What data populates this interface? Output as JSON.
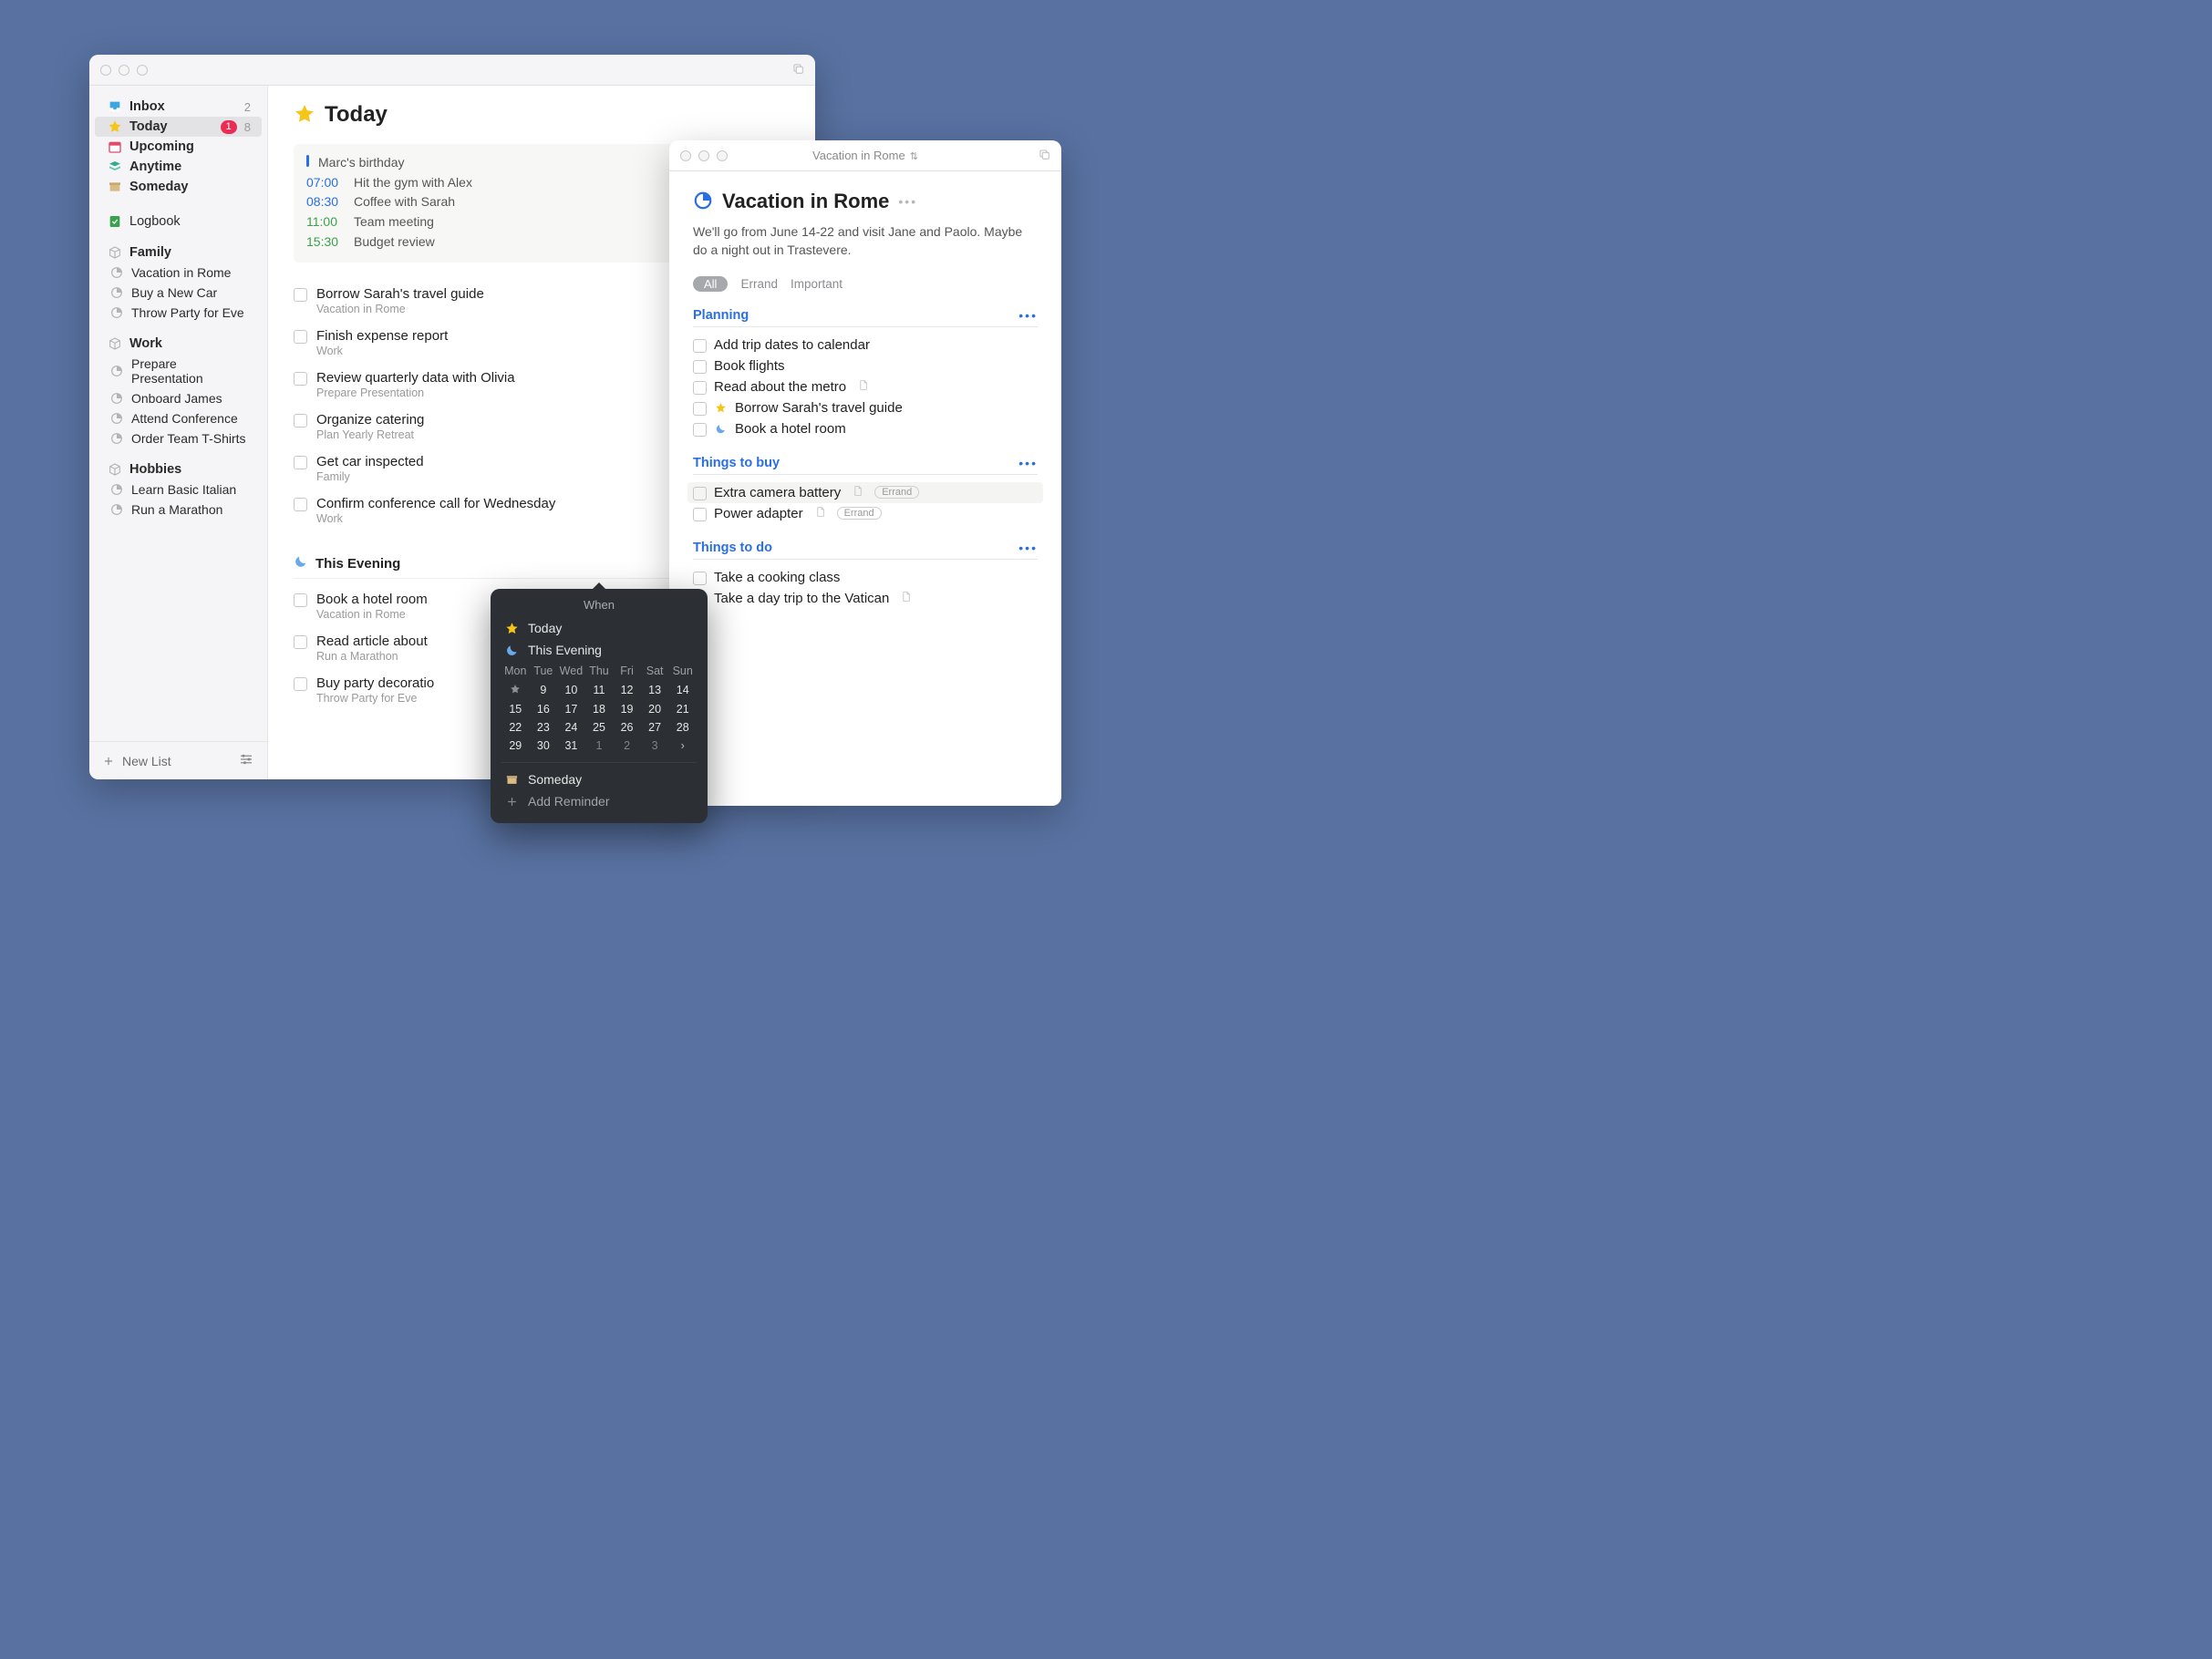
{
  "sidebar": {
    "smart": [
      {
        "icon": "inbox",
        "label": "Inbox",
        "count": "2"
      },
      {
        "icon": "star",
        "label": "Today",
        "badge": "1",
        "count": "8",
        "selected": true
      },
      {
        "icon": "calendar",
        "label": "Upcoming"
      },
      {
        "icon": "stack",
        "label": "Anytime"
      },
      {
        "icon": "archive",
        "label": "Someday"
      }
    ],
    "logbook": {
      "label": "Logbook"
    },
    "areas": [
      {
        "name": "Family",
        "projects": [
          "Vacation in Rome",
          "Buy a New Car",
          "Throw Party for Eve"
        ]
      },
      {
        "name": "Work",
        "projects": [
          "Prepare Presentation",
          "Onboard James",
          "Attend Conference",
          "Order Team T-Shirts"
        ]
      },
      {
        "name": "Hobbies",
        "projects": [
          "Learn Basic Italian",
          "Run a Marathon"
        ]
      }
    ],
    "newList": "New List"
  },
  "page": {
    "title": "Today",
    "agenda": [
      {
        "kind": "allday",
        "label": "Marc's birthday"
      },
      {
        "time": "07:00",
        "label": "Hit the gym with Alex",
        "color": "blue"
      },
      {
        "time": "08:30",
        "label": "Coffee with Sarah",
        "color": "blue"
      },
      {
        "time": "11:00",
        "label": "Team meeting",
        "color": "green"
      },
      {
        "time": "15:30",
        "label": "Budget review",
        "color": "green"
      }
    ],
    "tasks": [
      {
        "title": "Borrow Sarah's travel guide",
        "sub": "Vacation in Rome"
      },
      {
        "title": "Finish expense report",
        "sub": "Work"
      },
      {
        "title": "Review quarterly data with Olivia",
        "sub": "Prepare Presentation"
      },
      {
        "title": "Organize catering",
        "sub": "Plan Yearly Retreat"
      },
      {
        "title": "Get car inspected",
        "sub": "Family"
      },
      {
        "title": "Confirm conference call for Wednesday",
        "sub": "Work"
      }
    ],
    "eveningLabel": "This Evening",
    "evening": [
      {
        "title": "Book a hotel room",
        "sub": "Vacation in Rome"
      },
      {
        "title": "Read article about",
        "sub": "Run a Marathon"
      },
      {
        "title": "Buy party decoratio",
        "sub": "Throw Party for Eve"
      }
    ]
  },
  "when": {
    "title": "When",
    "today": "Today",
    "evening": "This Evening",
    "dow": [
      "Mon",
      "Tue",
      "Wed",
      "Thu",
      "Fri",
      "Sat",
      "Sun"
    ],
    "weeks": [
      [
        "★",
        "9",
        "10",
        "11",
        "12",
        "13",
        "14"
      ],
      [
        "15",
        "16",
        "17",
        "18",
        "19",
        "20",
        "21"
      ],
      [
        "22",
        "23",
        "24",
        "25",
        "26",
        "27",
        "28"
      ],
      [
        "29",
        "30",
        "31",
        "1",
        "2",
        "3",
        "▸"
      ]
    ],
    "someday": "Someday",
    "addReminder": "Add Reminder"
  },
  "project": {
    "titlebar": "Vacation in Rome",
    "title": "Vacation in Rome",
    "notes": "We'll go from June 14-22 and visit Jane and Paolo. Maybe do a night out in Trastevere.",
    "filters": {
      "all": "All",
      "errand": "Errand",
      "important": "Important"
    },
    "sections": [
      {
        "name": "Planning",
        "tasks": [
          {
            "title": "Add trip dates to calendar"
          },
          {
            "title": "Book flights"
          },
          {
            "title": "Read about the metro",
            "note": true
          },
          {
            "title": "Borrow Sarah's travel guide",
            "pre": "star"
          },
          {
            "title": "Book a hotel room",
            "pre": "moon"
          }
        ]
      },
      {
        "name": "Things to buy",
        "tasks": [
          {
            "title": "Extra camera battery",
            "note": true,
            "tag": "Errand",
            "hl": true
          },
          {
            "title": "Power adapter",
            "note": true,
            "tag": "Errand"
          }
        ]
      },
      {
        "name": "Things to do",
        "tasks": [
          {
            "title": "Take a cooking class"
          },
          {
            "title": "Take a day trip to the Vatican",
            "note": true
          }
        ]
      }
    ]
  }
}
